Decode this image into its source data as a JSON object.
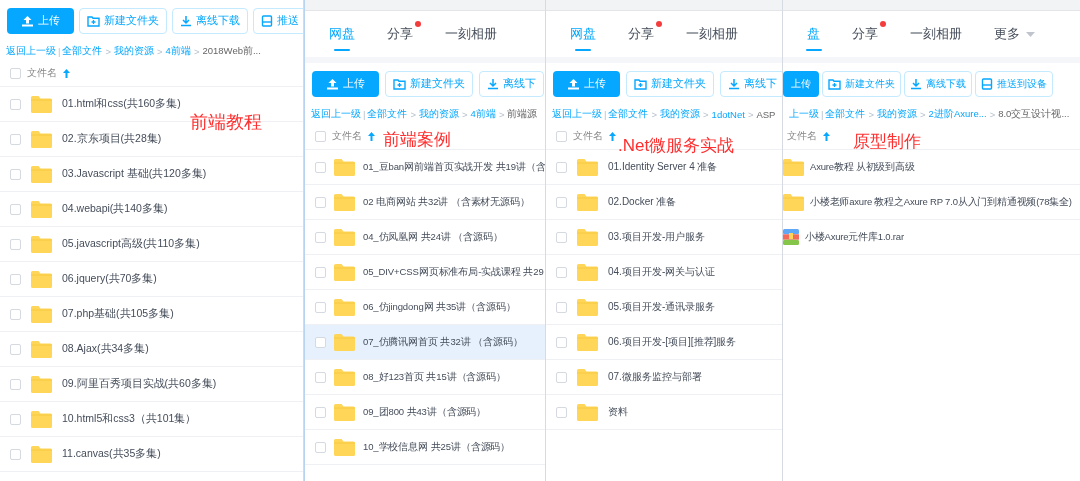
{
  "panels": [
    {
      "annotation": "前端教程",
      "toolbar": [
        {
          "label": "上传",
          "kind": "primary"
        },
        {
          "label": "新建文件夹",
          "kind": "outline"
        },
        {
          "label": "离线下载",
          "kind": "outline"
        },
        {
          "label": "推送",
          "kind": "outline"
        }
      ],
      "breadcrumb": [
        {
          "text": "返回上一级",
          "kind": "link"
        },
        {
          "text": "|",
          "kind": "bar"
        },
        {
          "text": "全部文件",
          "kind": "link"
        },
        {
          "text": ">",
          "kind": "sep"
        },
        {
          "text": "我的资源",
          "kind": "link"
        },
        {
          "text": ">",
          "kind": "sep"
        },
        {
          "text": "4前端",
          "kind": "link"
        },
        {
          "text": ">",
          "kind": "sep"
        },
        {
          "text": "2018Web前...",
          "kind": "current"
        }
      ],
      "header": {
        "label": "文件名",
        "checked": false
      },
      "rows": [
        {
          "name": "01.html和css(共160多集)",
          "kind": "folder",
          "checked": false,
          "selected": false
        },
        {
          "name": "02.京东项目(共28集)",
          "kind": "folder",
          "checked": false,
          "selected": false
        },
        {
          "name": "03.Javascript 基础(共120多集)",
          "kind": "folder",
          "checked": false,
          "selected": false
        },
        {
          "name": "04.webapi(共140多集)",
          "kind": "folder",
          "checked": false,
          "selected": false
        },
        {
          "name": "05.javascript高级(共110多集)",
          "kind": "folder",
          "checked": false,
          "selected": false
        },
        {
          "name": "06.jquery(共70多集)",
          "kind": "folder",
          "checked": false,
          "selected": false
        },
        {
          "name": "07.php基础(共105多集)",
          "kind": "folder",
          "checked": false,
          "selected": false
        },
        {
          "name": "08.Ajax(共34多集)",
          "kind": "folder",
          "checked": false,
          "selected": false
        },
        {
          "name": "09.阿里百秀项目实战(共60多集)",
          "kind": "folder",
          "checked": false,
          "selected": false
        },
        {
          "name": "10.html5和css3（共101集）",
          "kind": "folder",
          "checked": false,
          "selected": false
        },
        {
          "name": "11.canvas(共35多集)",
          "kind": "folder",
          "checked": false,
          "selected": false
        }
      ]
    },
    {
      "annotation": "前端案例",
      "tabs": [
        {
          "label": "网盘",
          "kind": "tab",
          "selected": true,
          "badge": false
        },
        {
          "label": "分享",
          "kind": "tab",
          "selected": false,
          "badge": true
        },
        {
          "label": "一刻相册",
          "kind": "tab",
          "selected": false,
          "badge": false
        }
      ],
      "toolbar": [
        {
          "label": "上传",
          "kind": "primary"
        },
        {
          "label": "新建文件夹",
          "kind": "outline"
        },
        {
          "label": "离线下",
          "kind": "outline"
        }
      ],
      "breadcrumb": [
        {
          "text": "返回上一级",
          "kind": "link"
        },
        {
          "text": "|",
          "kind": "bar"
        },
        {
          "text": "全部文件",
          "kind": "link"
        },
        {
          "text": ">",
          "kind": "sep"
        },
        {
          "text": "我的资源",
          "kind": "link"
        },
        {
          "text": ">",
          "kind": "sep"
        },
        {
          "text": "4前端",
          "kind": "link"
        },
        {
          "text": ">",
          "kind": "sep"
        },
        {
          "text": "前端源",
          "kind": "current"
        }
      ],
      "header": {
        "label": "文件名",
        "checked": false
      },
      "rows": [
        {
          "name": "01_豆ban网前端首页实战开发 共19讲（含",
          "kind": "folder",
          "checked": false,
          "selected": false
        },
        {
          "name": "02 电商网站 共32讲 （含素材无源码）",
          "kind": "folder",
          "checked": false,
          "selected": false
        },
        {
          "name": "04_仿凤凰网 共24讲 （含源码）",
          "kind": "folder",
          "checked": false,
          "selected": false
        },
        {
          "name": "05_DIV+CSS网页标准布局-实战课程 共29",
          "kind": "folder",
          "checked": false,
          "selected": false
        },
        {
          "name": "06_仿jingdong网 共35讲（含源码）",
          "kind": "folder",
          "checked": false,
          "selected": false
        },
        {
          "name": "07_仿腾讯网首页 共32讲 （含源码）",
          "kind": "folder",
          "checked": false,
          "selected": true
        },
        {
          "name": "08_好123首页 共15讲（含源码）",
          "kind": "folder",
          "checked": false,
          "selected": false
        },
        {
          "name": "09_团800 共43讲（含源码）",
          "kind": "folder",
          "checked": false,
          "selected": false
        },
        {
          "name": "10_学校信息网 共25讲（含源码）",
          "kind": "folder",
          "checked": false,
          "selected": false
        }
      ]
    },
    {
      "annotation": ".Net微服务实战",
      "tabs": [
        {
          "label": "网盘",
          "kind": "tab",
          "selected": true,
          "badge": false
        },
        {
          "label": "分享",
          "kind": "tab",
          "selected": false,
          "badge": true
        },
        {
          "label": "一刻相册",
          "kind": "tab",
          "selected": false,
          "badge": false
        }
      ],
      "toolbar": [
        {
          "label": "上传",
          "kind": "primary"
        },
        {
          "label": "新建文件夹",
          "kind": "outline"
        },
        {
          "label": "离线下",
          "kind": "outline"
        }
      ],
      "breadcrumb": [
        {
          "text": "返回上一级",
          "kind": "link"
        },
        {
          "text": "|",
          "kind": "bar"
        },
        {
          "text": "全部文件",
          "kind": "link"
        },
        {
          "text": ">",
          "kind": "sep"
        },
        {
          "text": "我的资源",
          "kind": "link"
        },
        {
          "text": ">",
          "kind": "sep"
        },
        {
          "text": "1dotNet",
          "kind": "link"
        },
        {
          "text": ">",
          "kind": "sep"
        },
        {
          "text": "ASP",
          "kind": "current"
        }
      ],
      "header": {
        "label": "文件名",
        "checked": false
      },
      "rows": [
        {
          "name": "01.Identity Server 4 准备",
          "kind": "folder",
          "checked": false,
          "selected": false
        },
        {
          "name": "02.Docker 准备",
          "kind": "folder",
          "checked": false,
          "selected": false
        },
        {
          "name": "03.项目开发-用户服务",
          "kind": "folder",
          "checked": false,
          "selected": false
        },
        {
          "name": "04.项目开发-网关与认证",
          "kind": "folder",
          "checked": false,
          "selected": false
        },
        {
          "name": "05.项目开发-通讯录服务",
          "kind": "folder",
          "checked": false,
          "selected": false
        },
        {
          "name": "06.项目开发-[项目][推荐]服务",
          "kind": "folder",
          "checked": false,
          "selected": false
        },
        {
          "name": "07.微服务监控与部署",
          "kind": "folder",
          "checked": false,
          "selected": false
        },
        {
          "name": "资料",
          "kind": "folder",
          "checked": false,
          "selected": false
        }
      ]
    },
    {
      "annotation": "原型制作",
      "tabs": [
        {
          "label": "盘",
          "kind": "tab",
          "selected": true,
          "badge": false
        },
        {
          "label": "分享",
          "kind": "tab",
          "selected": false,
          "badge": true
        },
        {
          "label": "一刻相册",
          "kind": "tab",
          "selected": false,
          "badge": false
        },
        {
          "label": "更多",
          "kind": "menu",
          "selected": false,
          "badge": false
        }
      ],
      "toolbar": [
        {
          "label": "上传",
          "kind": "primary"
        },
        {
          "label": "新建文件夹",
          "kind": "outline"
        },
        {
          "label": "离线下载",
          "kind": "outline"
        },
        {
          "label": "推送到设备",
          "kind": "outline"
        }
      ],
      "breadcrumb": [
        {
          "text": "上一级",
          "kind": "link"
        },
        {
          "text": "|",
          "kind": "bar"
        },
        {
          "text": "全部文件",
          "kind": "link"
        },
        {
          "text": ">",
          "kind": "sep"
        },
        {
          "text": "我的资源",
          "kind": "link"
        },
        {
          "text": ">",
          "kind": "sep"
        },
        {
          "text": "2进阶Axure...",
          "kind": "link"
        },
        {
          "text": ">",
          "kind": "sep"
        },
        {
          "text": "8.0交互设计视...",
          "kind": "current"
        }
      ],
      "header": {
        "label": "文件名"
      },
      "rows": [
        {
          "name": "Axure教程 从初级到高级",
          "kind": "folder",
          "selected": false
        },
        {
          "name": "小楼老师axure 教程之Axure RP 7.0从入门到精通视频(78集全)",
          "kind": "folder",
          "selected": false
        },
        {
          "name": "小楼Axure元件库1.0.rar",
          "kind": "archive",
          "selected": false
        }
      ]
    }
  ]
}
